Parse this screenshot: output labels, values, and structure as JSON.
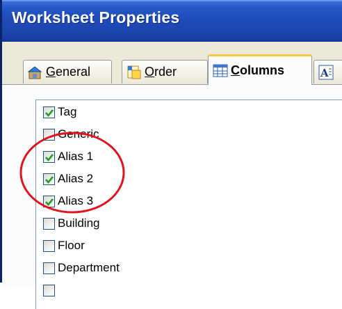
{
  "window": {
    "title": "Worksheet Properties"
  },
  "tabs": [
    {
      "label": "General",
      "mnemonic": "G",
      "icon": "general-icon",
      "active": false
    },
    {
      "label": "Order",
      "mnemonic": "O",
      "icon": "order-icon",
      "active": false
    },
    {
      "label": "Columns",
      "mnemonic": "C",
      "icon": "columns-icon",
      "active": true
    },
    {
      "label": "",
      "icon": "font-icon",
      "active": false
    }
  ],
  "columns": [
    {
      "label": "Tag",
      "checked": true
    },
    {
      "label": "Generic",
      "checked": false
    },
    {
      "label": "Alias 1",
      "checked": true
    },
    {
      "label": "Alias 2",
      "checked": true
    },
    {
      "label": "Alias 3",
      "checked": true
    },
    {
      "label": "Building",
      "checked": false
    },
    {
      "label": "Floor",
      "checked": false
    },
    {
      "label": "Department",
      "checked": false
    }
  ],
  "colors": {
    "title_bar": "#1e49b6",
    "highlight_ring": "#e0141c",
    "check": "#21a121"
  }
}
